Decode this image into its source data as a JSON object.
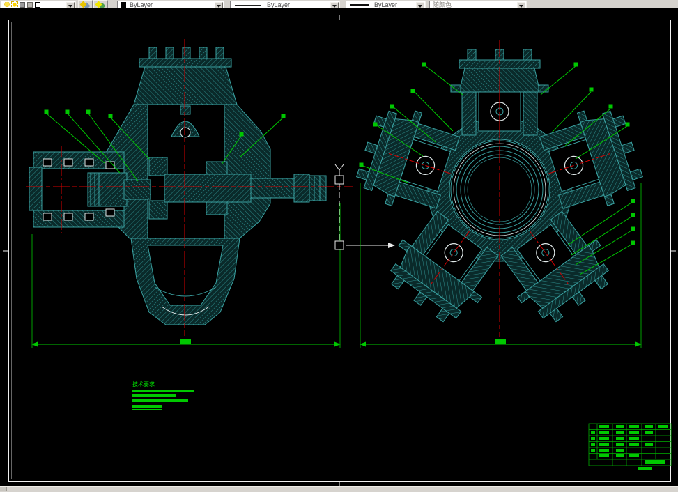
{
  "toolbar": {
    "layer_control": {
      "tooltip": "Layer Control"
    },
    "color_control": {
      "value": "ByLayer"
    },
    "linetype_control": {
      "value": "ByLayer"
    },
    "lineweight_control": {
      "value": "ByLayer"
    },
    "plotstyle_control": {
      "value": "随颜色"
    }
  },
  "drawing": {
    "background": "#000000",
    "frame_color": "#f0f0f0",
    "geometry_color": "#2f8f8f",
    "dimension_color": "#00c800",
    "centerline_color": "#d40000",
    "views": [
      {
        "name": "side-section-view"
      },
      {
        "name": "radial-front-view"
      }
    ],
    "notes": {
      "heading": "技术要求",
      "body_line_count": 4
    },
    "title_block": {
      "rows": 7,
      "columns": 6
    }
  }
}
